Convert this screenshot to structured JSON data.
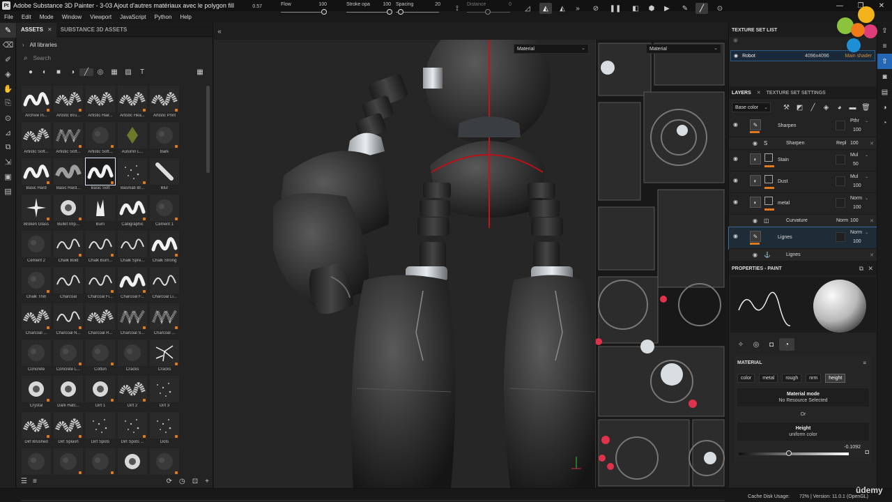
{
  "window": {
    "app_icon": "Pt",
    "title": "Adobe Substance 3D Painter - 3-03 Ajout d'autres matériaux avec le polygon fill",
    "controls": [
      "—",
      "❐",
      "✕"
    ]
  },
  "menu": [
    "File",
    "Edit",
    "Mode",
    "Window",
    "Viewport",
    "JavaScript",
    "Python",
    "Help"
  ],
  "left_tools": [
    {
      "name": "paint-brush-icon",
      "glyph": "✎"
    },
    {
      "name": "eraser-icon",
      "glyph": "⌫"
    },
    {
      "name": "projection-icon",
      "glyph": "✐"
    },
    {
      "name": "geometry-fill-icon",
      "glyph": "◈"
    },
    {
      "name": "smudge-icon",
      "glyph": "✋"
    },
    {
      "name": "clone-icon",
      "glyph": "⎘"
    },
    {
      "name": "picker-icon",
      "glyph": "⊙"
    },
    {
      "name": "measure-icon",
      "glyph": "⊿"
    },
    {
      "name": "bake-icon",
      "glyph": "⧉"
    },
    {
      "name": "transform-icon",
      "glyph": "⇲"
    },
    {
      "name": "polygon-fill-icon",
      "glyph": "▣"
    },
    {
      "name": "snapshot-icon",
      "glyph": "▤"
    }
  ],
  "assets": {
    "tabs": [
      {
        "label": "ASSETS",
        "active": true
      },
      {
        "label": "SUBSTANCE 3D ASSETS",
        "active": false
      }
    ],
    "breadcrumb": "All libraries",
    "search_placeholder": "Search",
    "filter_icons": [
      "●",
      "◐",
      "■",
      "◑",
      "╱",
      "◎",
      "▦",
      "▨",
      "T"
    ],
    "brushes": [
      {
        "name": "Archive In...",
        "style": "hard"
      },
      {
        "name": "Artistic Bru...",
        "style": "soft"
      },
      {
        "name": "Artistic Hair...",
        "style": "soft"
      },
      {
        "name": "Artistic Hea...",
        "style": "soft"
      },
      {
        "name": "Artistic Print",
        "style": "soft"
      },
      {
        "name": "Artistic Soft...",
        "style": "soft"
      },
      {
        "name": "Artistic Soft...",
        "style": "zig"
      },
      {
        "name": "Artistic Soft...",
        "style": "faint"
      },
      {
        "name": "Autumn L...",
        "style": "leaf"
      },
      {
        "name": "Bark",
        "style": "faint"
      },
      {
        "name": "Basic Hard",
        "style": "hard"
      },
      {
        "name": "Basic Hard...",
        "style": "softw"
      },
      {
        "name": "Basic Soft",
        "style": "hard",
        "selected": true
      },
      {
        "name": "Basmati Br...",
        "style": "dots"
      },
      {
        "name": "Blur",
        "style": "blur"
      },
      {
        "name": "Broken Glass",
        "style": "star"
      },
      {
        "name": "Bullet Imp...",
        "style": "splash"
      },
      {
        "name": "Burn",
        "style": "flame"
      },
      {
        "name": "Calligraphic",
        "style": "hard"
      },
      {
        "name": "Cement 1",
        "style": "faint"
      },
      {
        "name": "Cement 2",
        "style": "faint"
      },
      {
        "name": "Chalk Bold",
        "style": "thin"
      },
      {
        "name": "Chalk Burn...",
        "style": "thin"
      },
      {
        "name": "Chalk Spre...",
        "style": "thin"
      },
      {
        "name": "Chalk Strong",
        "style": "hard"
      },
      {
        "name": "Chalk Thin",
        "style": "faint"
      },
      {
        "name": "Charcoal",
        "style": "thin"
      },
      {
        "name": "Charcoal Fi...",
        "style": "thin"
      },
      {
        "name": "Charcoal F...",
        "style": "hard"
      },
      {
        "name": "Charcoal Li...",
        "style": "thin"
      },
      {
        "name": "Charcoal ...",
        "style": "soft"
      },
      {
        "name": "Charcoal N...",
        "style": "thin"
      },
      {
        "name": "Charcoal R...",
        "style": "soft"
      },
      {
        "name": "Charcoal S...",
        "style": "zig"
      },
      {
        "name": "Charcoal ...",
        "style": "zig"
      },
      {
        "name": "Concrete",
        "style": "faint"
      },
      {
        "name": "Concrete L...",
        "style": "faint"
      },
      {
        "name": "Cotton",
        "style": "faint"
      },
      {
        "name": "Cracks",
        "style": "faint"
      },
      {
        "name": "Cracks",
        "style": "cracks"
      },
      {
        "name": "Crystal",
        "style": "splash"
      },
      {
        "name": "Dark Hatc...",
        "style": "splash"
      },
      {
        "name": "Dirt 1",
        "style": "splash"
      },
      {
        "name": "Dirt 2",
        "style": "soft"
      },
      {
        "name": "Dirt 3",
        "style": "dots"
      },
      {
        "name": "Dirt Brushed",
        "style": "soft"
      },
      {
        "name": "Dirt Splash",
        "style": "soft"
      },
      {
        "name": "Dirt Spots",
        "style": "dots"
      },
      {
        "name": "Dirt Spots ...",
        "style": "dots"
      },
      {
        "name": "Dots",
        "style": "dots"
      },
      {
        "name": "",
        "style": "faint"
      },
      {
        "name": "",
        "style": "faint"
      },
      {
        "name": "",
        "style": "faint"
      },
      {
        "name": "",
        "style": "splash"
      },
      {
        "name": "",
        "style": "faint"
      }
    ]
  },
  "toolbar": {
    "size_value": "0.57",
    "flow": {
      "label": "Flow",
      "value": "100",
      "fraction": 1.0
    },
    "stroke": {
      "label": "Stroke opa",
      "value": "100",
      "fraction": 1.0
    },
    "spacing": {
      "label": "Spacing",
      "value": "20",
      "fraction": 0.05
    },
    "distance": {
      "label": "Distance",
      "value": "0",
      "fraction": 0.45
    }
  },
  "viewport": {
    "material_dropdown_left": "Material",
    "material_dropdown_right": "Material"
  },
  "texture_set_list": {
    "title": "TEXTURE SET LIST",
    "row": {
      "name": "Robot",
      "resolution": "4096x4096",
      "shader": "Main shader"
    }
  },
  "layers": {
    "tabs": [
      {
        "label": "LAYERS",
        "active": true
      },
      {
        "label": "TEXTURE SET SETTINGS",
        "active": false
      }
    ],
    "channel": "Base color",
    "items": [
      {
        "name": "Sharpen",
        "blend": "Pthr",
        "opacity": "100",
        "kind": "paint",
        "sub": false
      },
      {
        "name": "Sharpen",
        "blend": "Repl",
        "opacity": "100",
        "kind": "filter",
        "sub": true
      },
      {
        "name": "Stain",
        "blend": "Mul",
        "opacity": "50",
        "kind": "fill",
        "sub": false
      },
      {
        "name": "Dust",
        "blend": "Mul",
        "opacity": "100",
        "kind": "fill",
        "sub": false
      },
      {
        "name": "metal",
        "blend": "Norm",
        "opacity": "100",
        "kind": "fill",
        "sub": false
      },
      {
        "name": "Curvature",
        "blend": "Norm",
        "opacity": "100",
        "kind": "generator",
        "sub": true
      },
      {
        "name": "Lignes",
        "blend": "Norm",
        "opacity": "100",
        "kind": "paint",
        "sub": false,
        "selected": true
      },
      {
        "name": "Lignes",
        "blend": "",
        "opacity": "",
        "kind": "anchor",
        "sub": true
      }
    ]
  },
  "properties": {
    "title": "PROPERTIES - PAINT",
    "material_title": "MATERIAL",
    "channels": [
      {
        "label": "color",
        "on": false
      },
      {
        "label": "metal",
        "on": false
      },
      {
        "label": "rough",
        "on": false
      },
      {
        "label": "nrm",
        "on": false
      },
      {
        "label": "height",
        "on": true
      }
    ],
    "material_mode_label": "Material mode",
    "material_mode_value": "No Resource Selected",
    "or_label": "Or",
    "height_label": "Height",
    "height_value": "uniform color",
    "height_number": "-0.1092",
    "height_fraction": 0.45
  },
  "status": {
    "cache": "Cache Disk Usage:",
    "percent": "72%",
    "version": "| Version: 11.0.1 (OpenGL)",
    "watermark": "ûdemy"
  }
}
